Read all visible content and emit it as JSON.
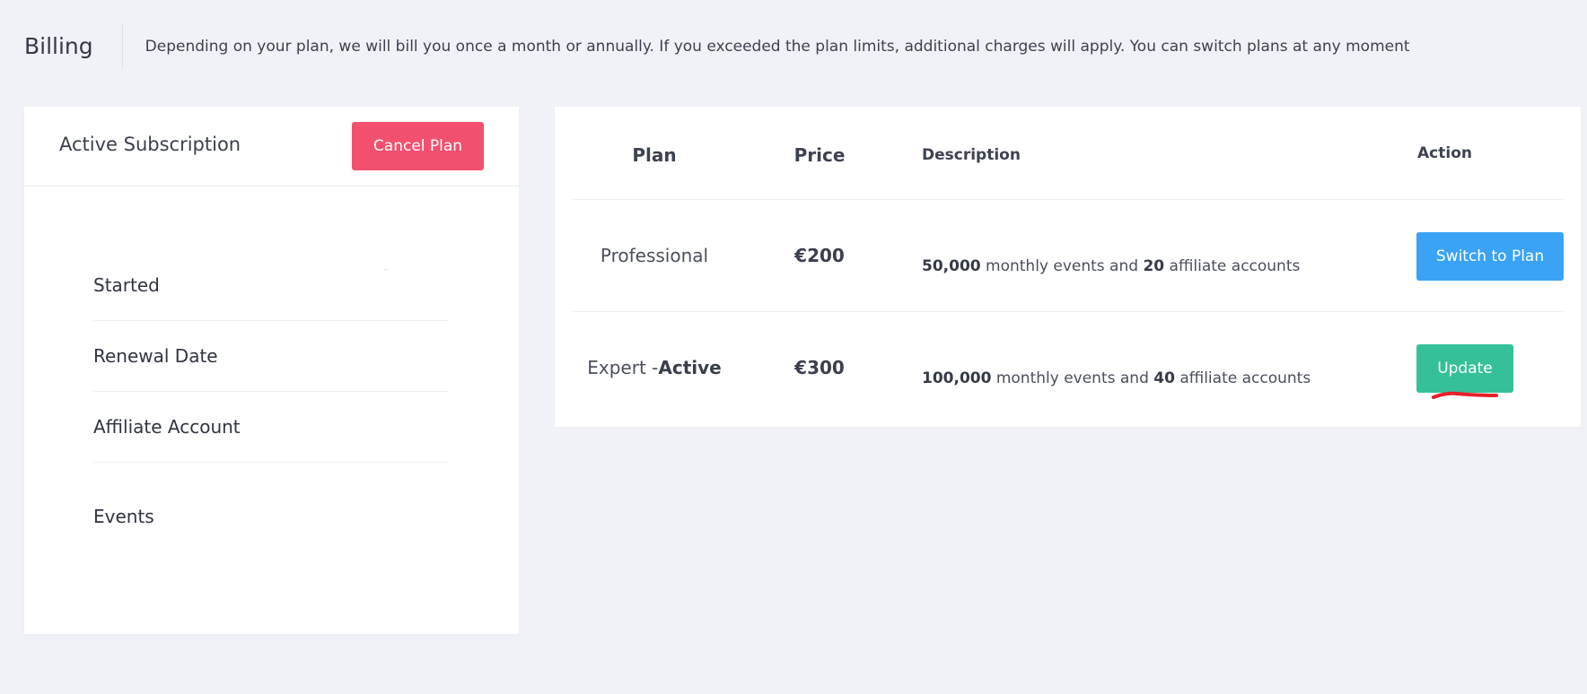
{
  "header": {
    "title": "Billing",
    "description": "Depending on your plan, we will bill you once a month or annually. If you exceeded the plan limits, additional charges will apply. You can switch plans at any moment"
  },
  "subscription": {
    "title": "Active Subscription",
    "cancel_label": "Cancel Plan",
    "rows": [
      {
        "label": "Started"
      },
      {
        "label": "Renewal Date"
      },
      {
        "label": "Affiliate Account"
      },
      {
        "label": "Events"
      }
    ]
  },
  "plans": {
    "columns": {
      "plan": "Plan",
      "price": "Price",
      "description": "Description",
      "action": "Action"
    },
    "rows": [
      {
        "plan_name": "Professional",
        "active_suffix": "",
        "price": "€200",
        "events": "50,000",
        "events_text": " monthly events and ",
        "affiliates": "20",
        "affiliates_text": " affiliate accounts",
        "action_label": "Switch to Plan"
      },
      {
        "plan_name": "Expert -",
        "active_suffix": "Active",
        "price": "€300",
        "events": "100,000",
        "events_text": " monthly events and ",
        "affiliates": "40",
        "affiliates_text": " affiliate accounts",
        "action_label": "Update"
      }
    ]
  },
  "colors": {
    "background": "#f1f2f7",
    "cancel": "#f2506e",
    "switch": "#3aa3f5",
    "update": "#36c09a",
    "annotation": "#e8202a"
  }
}
